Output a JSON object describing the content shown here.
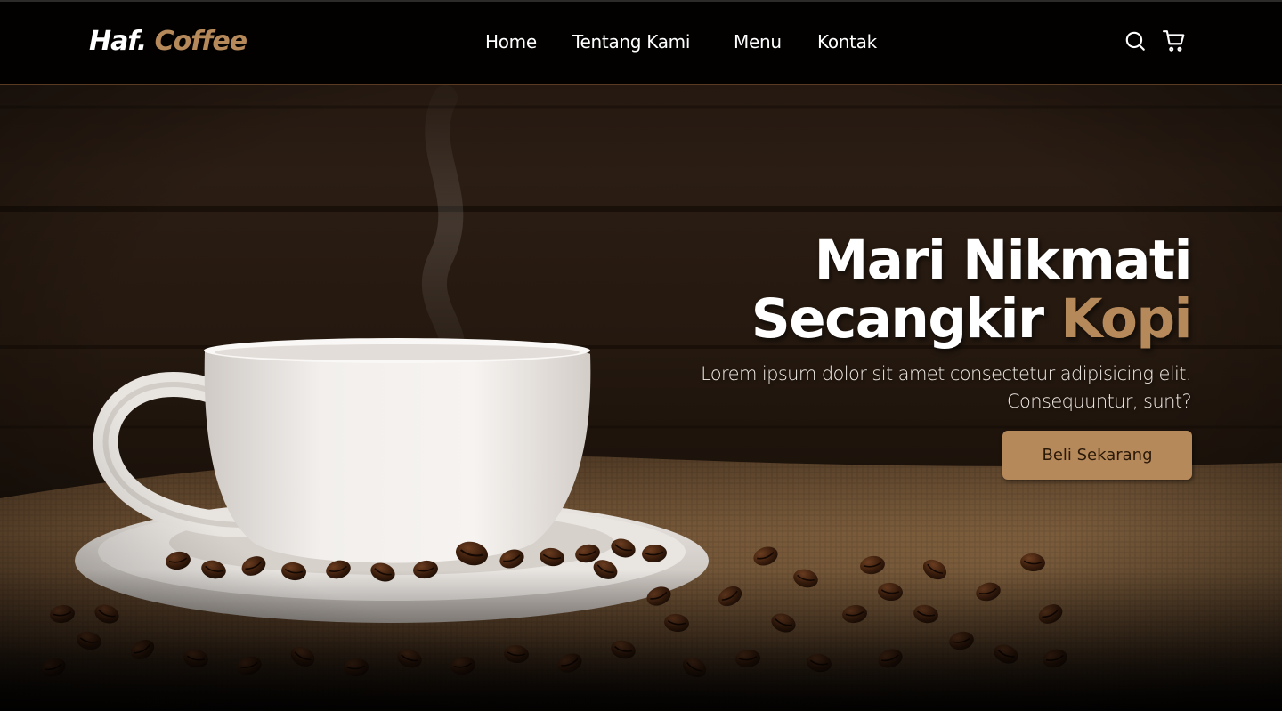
{
  "navbar": {
    "brand_primary": "Haf.",
    "brand_accent": "Coffee",
    "links": [
      {
        "label": "Home"
      },
      {
        "label": "Tentang Kami"
      },
      {
        "label": "Menu"
      },
      {
        "label": "Kontak"
      }
    ],
    "icons": [
      "search-icon",
      "shopping-cart-icon"
    ]
  },
  "hero": {
    "headline_line1": "Mari Nikmati",
    "headline_line2_main": "Secangkir",
    "headline_line2_accent": "Kopi",
    "subtitle_line1": "Lorem ipsum dolor sit amet consectetur adipisicing elit.",
    "subtitle_line2": "Consequuntur, sunt?",
    "cta_label": "Beli Sekarang",
    "background_image": "coffee-cup-on-saucer-with-beans-photo"
  },
  "colors": {
    "accent": "#b6895b",
    "navbar_bg": "#020100",
    "text_light": "#ffffff",
    "cta_text": "#2b1908"
  }
}
